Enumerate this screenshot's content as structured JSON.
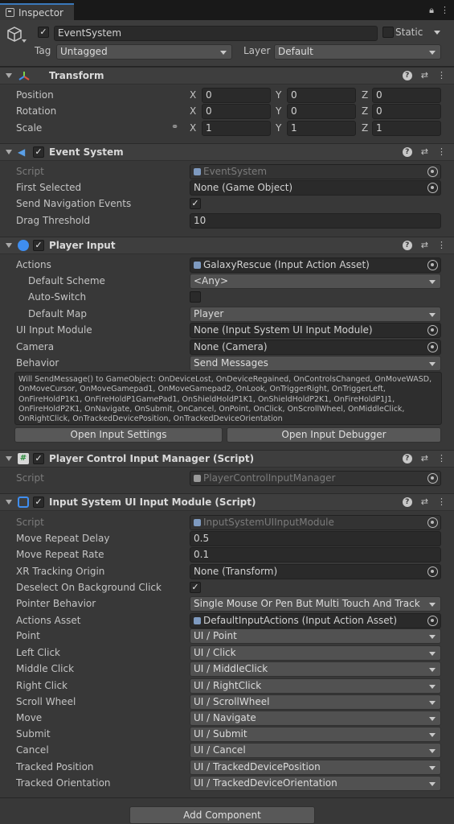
{
  "tab": {
    "title": "Inspector"
  },
  "gameobject": {
    "name": "EventSystem",
    "static_label": "Static",
    "tag_label": "Tag",
    "tag_value": "Untagged",
    "layer_label": "Layer",
    "layer_value": "Default"
  },
  "transform": {
    "title": "Transform",
    "rows": [
      {
        "label": "Position",
        "x": "0",
        "y": "0",
        "z": "0"
      },
      {
        "label": "Rotation",
        "x": "0",
        "y": "0",
        "z": "0"
      },
      {
        "label": "Scale",
        "x": "1",
        "y": "1",
        "z": "1"
      }
    ],
    "axis": {
      "x": "X",
      "y": "Y",
      "z": "Z"
    }
  },
  "event_system": {
    "title": "Event System",
    "script_label": "Script",
    "script_value": "EventSystem",
    "first_selected_label": "First Selected",
    "first_selected_value": "None (Game Object)",
    "send_nav_label": "Send Navigation Events",
    "drag_label": "Drag Threshold",
    "drag_value": "10"
  },
  "player_input": {
    "title": "Player Input",
    "actions_label": "Actions",
    "actions_value": "GalaxyRescue (Input Action Asset)",
    "scheme_label": "Default Scheme",
    "scheme_value": "<Any>",
    "autoswitch_label": "Auto-Switch",
    "map_label": "Default Map",
    "map_value": "Player",
    "ui_module_label": "UI Input Module",
    "ui_module_value": "None (Input System UI Input Module)",
    "camera_label": "Camera",
    "camera_value": "None (Camera)",
    "behavior_label": "Behavior",
    "behavior_value": "Send Messages",
    "help_text": "Will SendMessage() to GameObject: OnDeviceLost, OnDeviceRegained, OnControlsChanged, OnMoveWASD, OnMoveCursor, OnMoveGamepad1, OnMoveGamepad2, OnLook, OnTriggerRight, OnTriggerLeft, OnFireHoldP1K1, OnFireHoldP1GamePad1, OnShieldHoldP1K1, OnShieldHoldP2K1, OnFireHoldP1J1, OnFireHoldP2K1, OnNavigate, OnSubmit, OnCancel, OnPoint, OnClick, OnScrollWheel, OnMiddleClick, OnRightClick, OnTrackedDevicePosition, OnTrackedDeviceOrientation",
    "open_settings": "Open Input Settings",
    "open_debugger": "Open Input Debugger"
  },
  "pcim": {
    "title": "Player Control Input Manager (Script)",
    "script_label": "Script",
    "script_value": "PlayerControlInputManager"
  },
  "isuim": {
    "title": "Input System UI Input Module (Script)",
    "script_label": "Script",
    "script_value": "InputSystemUIInputModule",
    "repeat_delay_label": "Move Repeat Delay",
    "repeat_delay_value": "0.5",
    "repeat_rate_label": "Move Repeat Rate",
    "repeat_rate_value": "0.1",
    "xr_label": "XR Tracking Origin",
    "xr_value": "None (Transform)",
    "deselect_label": "Deselect On Background Click",
    "pointer_label": "Pointer Behavior",
    "pointer_value": "Single Mouse Or Pen But Multi Touch And Track",
    "actions_asset_label": "Actions Asset",
    "actions_asset_value": "DefaultInputActions (Input Action Asset)",
    "bindings": [
      {
        "label": "Point",
        "value": "UI / Point"
      },
      {
        "label": "Left Click",
        "value": "UI / Click"
      },
      {
        "label": "Middle Click",
        "value": "UI / MiddleClick"
      },
      {
        "label": "Right Click",
        "value": "UI / RightClick"
      },
      {
        "label": "Scroll Wheel",
        "value": "UI / ScrollWheel"
      },
      {
        "label": "Move",
        "value": "UI / Navigate"
      },
      {
        "label": "Submit",
        "value": "UI / Submit"
      },
      {
        "label": "Cancel",
        "value": "UI / Cancel"
      },
      {
        "label": "Tracked Position",
        "value": "UI / TrackedDevicePosition"
      },
      {
        "label": "Tracked Orientation",
        "value": "UI / TrackedDeviceOrientation"
      }
    ]
  },
  "footer": {
    "add_component": "Add Component"
  },
  "icons": {
    "lock": "lock-icon",
    "menu": "kebab-menu-icon",
    "help": "help-icon",
    "presets": "presets-icon"
  }
}
